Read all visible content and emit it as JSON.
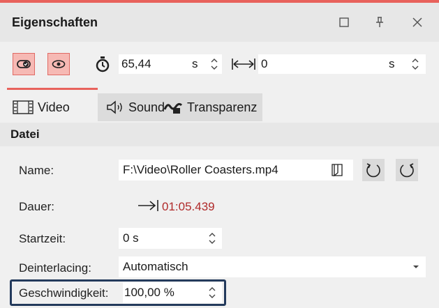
{
  "panel": {
    "title": "Eigenschaften",
    "accent_color": "#e8625c"
  },
  "toolbar": {
    "duration_value": "65,44",
    "duration_unit": "s",
    "offset_value": "0",
    "offset_unit": "s"
  },
  "tabs": [
    {
      "label": "Video",
      "icon": "film-icon",
      "active": true
    },
    {
      "label": "Sound",
      "icon": "speaker-icon",
      "active": false
    },
    {
      "label": "Transparenz",
      "icon": "transparency-icon",
      "active": false
    }
  ],
  "section": {
    "title": "Datei"
  },
  "fields": {
    "name_label": "Name:",
    "name_value": "F:\\Video\\Roller Coasters.mp4",
    "dauer_label": "Dauer:",
    "dauer_value": "01:05.439",
    "dauer_color": "#b02a2a",
    "startzeit_label": "Startzeit:",
    "startzeit_value": "0 s",
    "deinterlacing_label": "Deinterlacing:",
    "deinterlacing_value": "Automatisch",
    "speed_label": "Geschwindigkeit:",
    "speed_value": "100,00 %"
  }
}
